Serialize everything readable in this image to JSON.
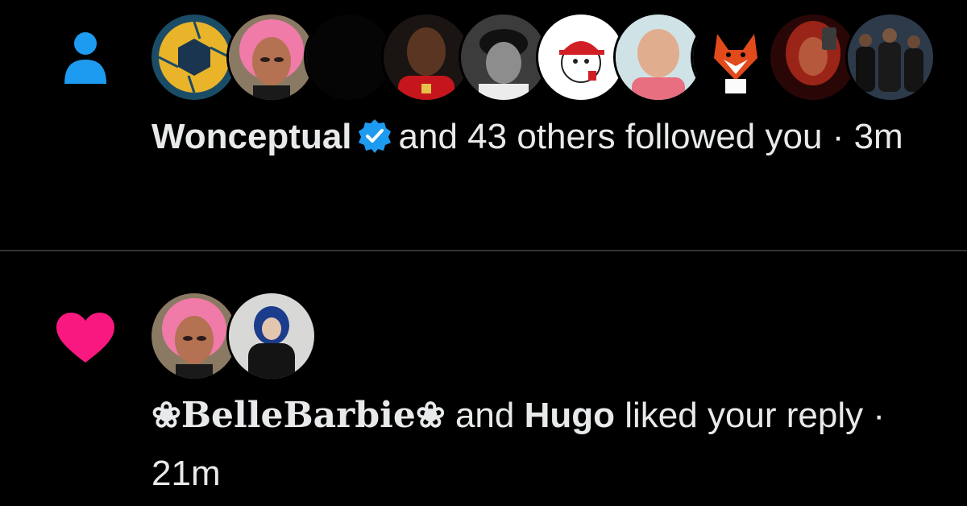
{
  "notifications": [
    {
      "type_icon": "person-icon",
      "icon_color": "#1d9bf0",
      "avatar_count": 10,
      "actor": "Wonceptual",
      "verified": true,
      "action": "and 43 others followed you",
      "dot": "·",
      "time": "3m"
    },
    {
      "type_icon": "heart-icon",
      "icon_color": "#f91880",
      "avatar_count": 2,
      "actor": "❀BelleBarbie❀",
      "joiner": "and",
      "actor2": "Hugo",
      "action": "liked your reply",
      "dot": "·",
      "time": "21m"
    }
  ],
  "colors": {
    "background": "#000000",
    "text": "#e7e9ea",
    "divider": "#2f3336",
    "verified_badge": "#1d9bf0"
  }
}
